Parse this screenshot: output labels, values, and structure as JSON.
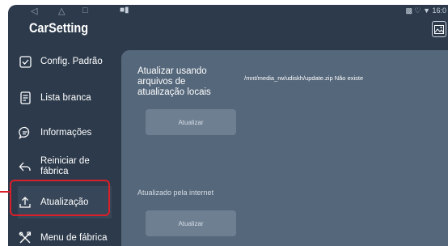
{
  "statusbar": {
    "nav_back": "◁",
    "nav_home": "△",
    "nav_recent": "□",
    "left_icons": "■▮",
    "right_text": "▩ ♡ ▼ 16:0"
  },
  "app": {
    "title": "CarSetting",
    "header_icon": "image-icon"
  },
  "sidebar": {
    "items": [
      {
        "label": "Config. Padrão",
        "icon": "checkbox-icon"
      },
      {
        "label": "Lista branca",
        "icon": "document-icon"
      },
      {
        "label": "Informações",
        "icon": "chat-bubble-icon"
      },
      {
        "label": "Reiniciar de fábrica",
        "icon": "reset-arrow-icon"
      },
      {
        "label": "Atualização",
        "icon": "upload-icon",
        "active": true
      },
      {
        "label": "Menu de fábrica",
        "icon": "tools-icon"
      }
    ]
  },
  "main": {
    "local_update": {
      "title": "Atualizar usando arquivos de atualização locais",
      "path": "/mnt/media_rw/udiskh/update.zip Não existe",
      "button": "Atualizar"
    },
    "internet_update": {
      "title": "Atualizado pela internet",
      "button": "Atualizar"
    }
  }
}
